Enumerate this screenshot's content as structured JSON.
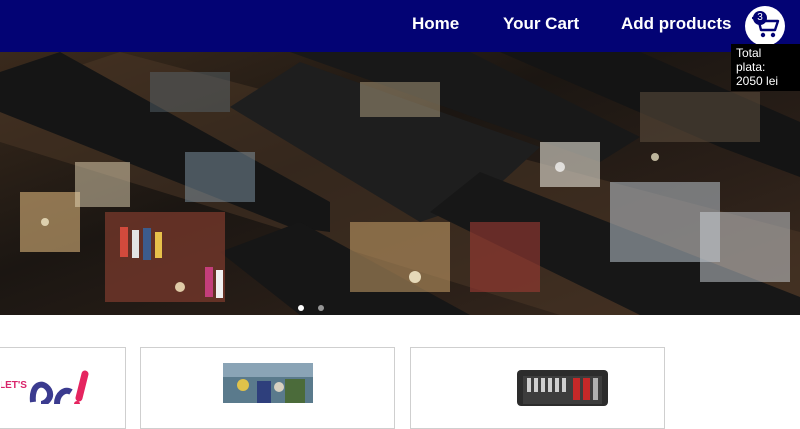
{
  "nav": {
    "links": [
      {
        "label": "Home"
      },
      {
        "label": "Your Cart"
      },
      {
        "label": "Add products"
      }
    ],
    "cart": {
      "icon": "shopping-cart-icon",
      "badge_count": "3",
      "total_lines": [
        "Total",
        "plata:",
        "2050 lei"
      ]
    },
    "background_color": "#030374"
  },
  "carousel": {
    "slide_count": 2,
    "active_index": 0
  },
  "products": [
    {
      "image_label": "LET'S"
    },
    {
      "image_label": ""
    },
    {
      "image_label": ""
    }
  ]
}
